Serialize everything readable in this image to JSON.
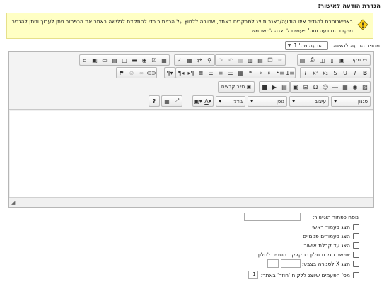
{
  "page": {
    "title": "הגדרת הודעה לאישור:"
  },
  "notice": {
    "text": "באפשרותכם להגדיר איזו הודעה/באנר תוצג למבקרים באתר, שחובה ללחוץ על הכפתור כדי להתקדם לגלישה באתר.את הכפתור ניתן לערוך וניתן להגדיר מיקום המודעה וסס' פעמים להצגה למשתמש"
  },
  "template": {
    "label": "מספר הודעה להצגה:",
    "selected": "הודעה מס' 1"
  },
  "editor": {
    "source_label": "מקור",
    "gallery_label": "סייר קבצים",
    "combos": {
      "styles": "סגנון",
      "format": "עיצוב",
      "font": "גופן",
      "size": "גודל"
    },
    "resize_glyph": "◢",
    "toolbar_icons": {
      "row1": [
        "source-icon",
        "save-icon",
        "new-page-icon",
        "preview-icon",
        "print-icon",
        "templates-icon",
        "cut-icon",
        "copy-icon",
        "paste-icon",
        "paste-text-icon",
        "paste-word-icon",
        "undo-icon",
        "redo-icon",
        "find-icon",
        "replace-icon",
        "select-all-icon",
        "spellcheck-icon",
        "form-icon",
        "checkbox-icon",
        "radio-icon",
        "textfield-icon",
        "textarea-icon",
        "select-field-icon",
        "button-icon",
        "image-button-icon",
        "hidden-field-icon"
      ],
      "row2": [
        "bold-icon",
        "italic-icon",
        "underline-icon",
        "strike-icon",
        "subscript-icon",
        "superscript-icon",
        "remove-format-icon",
        "numbered-list-icon",
        "bulleted-list-icon",
        "outdent-icon",
        "indent-icon",
        "blockquote-icon",
        "div-icon",
        "align-left-icon",
        "align-center-icon",
        "align-right-icon",
        "justify-icon",
        "ltr-icon",
        "rtl-icon",
        "language-icon",
        "link-icon",
        "unlink-icon",
        "anchor-icon"
      ],
      "row3": [
        "image-icon",
        "flash-icon",
        "table-icon",
        "horizontal-rule-icon",
        "smiley-icon",
        "special-char-icon",
        "page-break-icon",
        "iframe-icon",
        "youtube-icon",
        "gallery-icon"
      ],
      "row4": [
        "text-color-icon",
        "bg-color-icon",
        "maximize-icon",
        "show-blocks-icon",
        "about-icon"
      ]
    }
  },
  "options": {
    "button_text_label": "נוסח כפתור האישור:",
    "button_text_value": "",
    "items": [
      {
        "label": "הצג בעמוד ראשי",
        "checked": false
      },
      {
        "label": "הצג בעמודים פנימיים",
        "checked": false
      },
      {
        "label": "הצג עד קבלת אישור",
        "checked": false
      },
      {
        "label": "אפשר סגירת חלון בהקלקה מסביב לחלון",
        "checked": false
      },
      {
        "label": "הצג X לסגירה בצבע:",
        "checked": false
      },
      {
        "label": "מס' הפעמים שיוצג ללקוח 'חוזר' באתר:",
        "checked": false
      }
    ],
    "times_value": "1"
  }
}
